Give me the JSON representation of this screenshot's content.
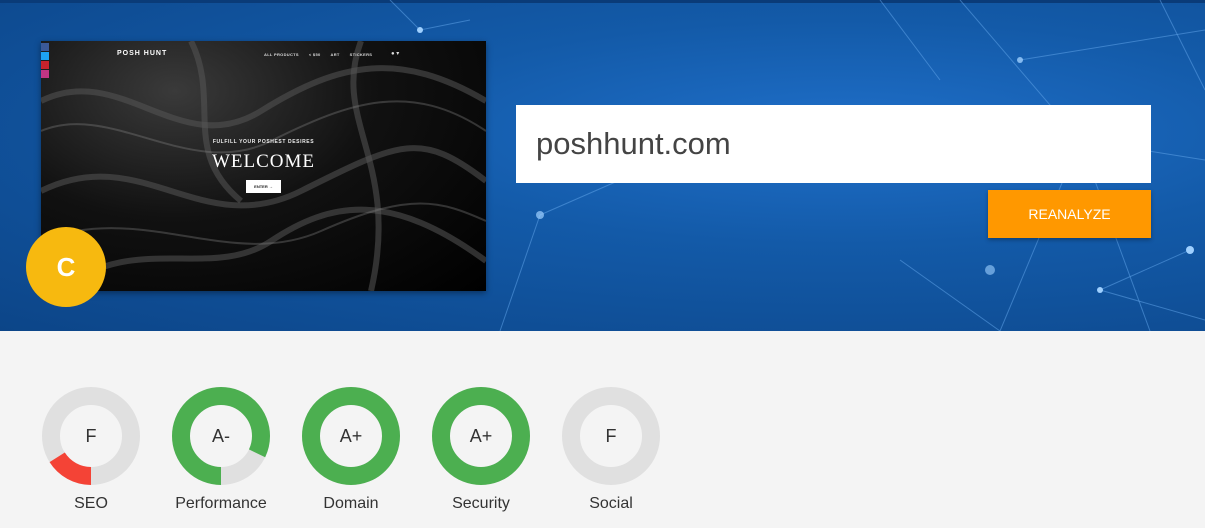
{
  "site": {
    "url": "poshhunt.com",
    "overall_grade": "C",
    "reanalyze_label": "REANALYZE"
  },
  "preview": {
    "brand": "POSH HUNT",
    "nav": [
      "ALL PRODUCTS",
      "< $50",
      "ART",
      "STICKERS"
    ],
    "tagline": "FULFILL YOUR POSHEST DESIRES",
    "headline": "WELCOME",
    "enter_label": "ENTER →",
    "social_colors": [
      "#3b5998",
      "#1da1f2",
      "#c8232c",
      "#c13584"
    ]
  },
  "scores": [
    {
      "label": "SEO",
      "grade": "F",
      "fill": 0.16,
      "color": "#f44336"
    },
    {
      "label": "Performance",
      "grade": "A-",
      "fill": 0.82,
      "color": "#4caf50"
    },
    {
      "label": "Domain",
      "grade": "A+",
      "fill": 1.0,
      "color": "#4caf50"
    },
    {
      "label": "Security",
      "grade": "A+",
      "fill": 1.0,
      "color": "#4caf50"
    },
    {
      "label": "Social",
      "grade": "F",
      "fill": 0.0,
      "color": "#4caf50"
    }
  ],
  "colors": {
    "track": "#e0e0e0",
    "badge": "#f7b90f",
    "button": "#ff9800",
    "hero": "#135aa8"
  }
}
